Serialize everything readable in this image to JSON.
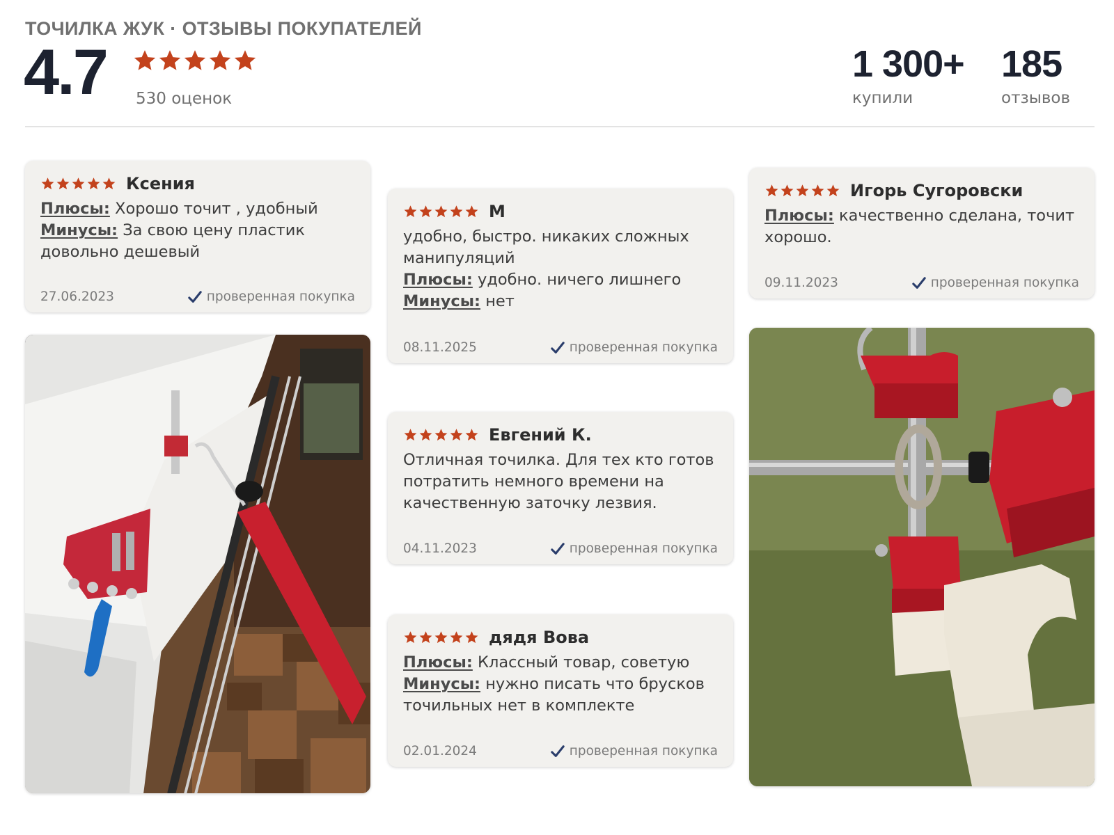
{
  "header": {
    "title": "ТОЧИЛКА ЖУК · ОТЗЫВЫ ПОКУПАТЕЛЕЙ",
    "score": "4.7",
    "ratings_count": "530 оценок",
    "stats": [
      {
        "value": "1 300+",
        "label": "купили"
      },
      {
        "value": "185",
        "label": "отзывов"
      }
    ]
  },
  "colors": {
    "star": "#c3421c",
    "check": "#2a3d6b",
    "card_bg": "#f2f1ee"
  },
  "icons": {
    "star": "star-icon",
    "check": "checkmark-icon"
  },
  "reviews": [
    {
      "author": "Ксения",
      "stars": 5,
      "pros_label": "Плюсы:",
      "pros": " Хорошо точит , удобный",
      "cons_label": "Минусы:",
      "cons": " За свою цену пластик довольно дешевый",
      "date": "27.06.2023",
      "verified": "проверенная покупка"
    },
    {
      "author": "М",
      "stars": 5,
      "text": "удобно, быстро. никаких сложных манипуляций",
      "pros_label": "Плюсы:",
      "pros": " удобно. ничего лишнего",
      "cons_label": "Минусы:",
      "cons": " нет",
      "date": "08.11.2025",
      "verified": "проверенная покупка"
    },
    {
      "author": "Игорь Сугоровски",
      "stars": 5,
      "pros_label": "Плюсы:",
      "pros": " качественно сделана, точит хорошо.",
      "date": "09.11.2023",
      "verified": "проверенная покупка"
    },
    {
      "author": "Евгений К.",
      "stars": 5,
      "text": "Отличная точилка. Для тех кто готов потратить немного времени на качественную заточку лезвия.",
      "date": "04.11.2023",
      "verified": "проверенная покупка"
    },
    {
      "author": "дядя Вова",
      "stars": 5,
      "pros_label": "Плюсы:",
      "pros": " Классный товар, советую",
      "cons_label": "Минусы:",
      "cons": " нужно писать что брусков точильных нет в комплекте",
      "date": "02.01.2024",
      "verified": "проверенная покупка"
    }
  ]
}
